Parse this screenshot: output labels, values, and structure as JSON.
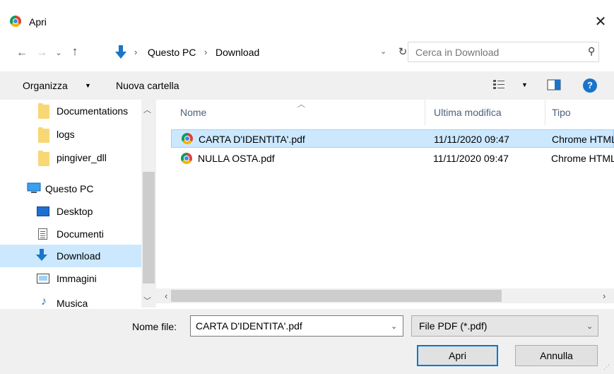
{
  "window": {
    "title": "Apri",
    "close_glyph": "✕"
  },
  "nav": {
    "back": "←",
    "forward": "→",
    "recent": "⌄",
    "up": "↑",
    "breadcrumb": [
      "Questo PC",
      "Download"
    ],
    "breadcrumb_sep": "›",
    "refresh": "↻",
    "search_placeholder": "Cerca in Download"
  },
  "toolbar": {
    "organize": "Organizza",
    "new_folder": "Nuova cartella",
    "help": "?"
  },
  "sidebar": {
    "items": [
      {
        "label": "Documentations",
        "icon": "folder-icon"
      },
      {
        "label": "logs",
        "icon": "folder-icon"
      },
      {
        "label": "pingiver_dll",
        "icon": "folder-icon"
      },
      {
        "label": "Questo PC",
        "icon": "pc-icon"
      },
      {
        "label": "Desktop",
        "icon": "desktop-icon"
      },
      {
        "label": "Documenti",
        "icon": "documents-icon"
      },
      {
        "label": "Download",
        "icon": "download-icon"
      },
      {
        "label": "Immagini",
        "icon": "pictures-icon"
      },
      {
        "label": "Musica",
        "icon": "music-icon"
      }
    ],
    "selected": "Download"
  },
  "file_list": {
    "columns": [
      "Nome",
      "Ultima modifica",
      "Tipo"
    ],
    "rows": [
      {
        "name": "CARTA D'IDENTITA'.pdf",
        "modified": "11/11/2020 09:47",
        "type": "Chrome HTML",
        "selected": true
      },
      {
        "name": "NULLA OSTA.pdf",
        "modified": "11/11/2020 09:47",
        "type": "Chrome HTML",
        "selected": false
      }
    ]
  },
  "bottom": {
    "filename_label": "Nome file:",
    "filename_value": "CARTA D'IDENTITA'.pdf",
    "filetype_value": "File PDF (*.pdf)",
    "open_label": "Apri",
    "cancel_label": "Annulla"
  },
  "colors": {
    "selection": "#cce8ff",
    "accent": "#0078d7",
    "header_text": "#4c607a"
  }
}
